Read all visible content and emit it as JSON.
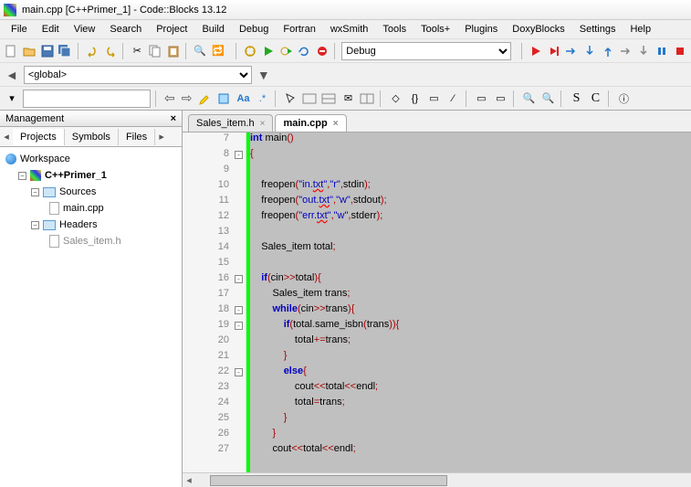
{
  "title": "main.cpp [C++Primer_1] - Code::Blocks 13.12",
  "menu": [
    "File",
    "Edit",
    "View",
    "Search",
    "Project",
    "Build",
    "Debug",
    "Fortran",
    "wxSmith",
    "Tools",
    "Tools+",
    "Plugins",
    "DoxyBlocks",
    "Settings",
    "Help"
  ],
  "scope_combo": "<global>",
  "build_target": "Debug",
  "management": {
    "title": "Management",
    "tabs": [
      "Projects",
      "Symbols",
      "Files"
    ],
    "active_tab": 0,
    "tree": {
      "workspace": "Workspace",
      "project": "C++Primer_1",
      "folders": [
        {
          "name": "Sources",
          "files": [
            "main.cpp"
          ]
        },
        {
          "name": "Headers",
          "files": [
            "Sales_item.h"
          ]
        }
      ]
    }
  },
  "editor": {
    "tabs": [
      {
        "label": "Sales_item.h",
        "active": false
      },
      {
        "label": "main.cpp",
        "active": true
      }
    ],
    "lines": [
      {
        "n": 7,
        "fold": "",
        "html": "<span class='kw'>int</span> main<span class='op'>()</span>"
      },
      {
        "n": 8,
        "fold": "-",
        "html": "<span class='op'>{</span>"
      },
      {
        "n": 9,
        "fold": "",
        "html": ""
      },
      {
        "n": 10,
        "fold": "",
        "html": "    freopen<span class='op'>(</span><span class='str'>\"in.<span class='err'>txt</span>\"</span><span class='op'>,</span><span class='str'>\"r\"</span><span class='op'>,</span>stdin<span class='op'>);</span>"
      },
      {
        "n": 11,
        "fold": "",
        "html": "    freopen<span class='op'>(</span><span class='str'>\"out.<span class='err'>txt</span>\"</span><span class='op'>,</span><span class='str'>\"w\"</span><span class='op'>,</span>stdout<span class='op'>);</span>"
      },
      {
        "n": 12,
        "fold": "",
        "html": "    freopen<span class='op'>(</span><span class='str'>\"err.<span class='err'>txt</span>\"</span><span class='op'>,</span><span class='str'>\"w\"</span><span class='op'>,</span>stderr<span class='op'>);</span>"
      },
      {
        "n": 13,
        "fold": "",
        "html": ""
      },
      {
        "n": 14,
        "fold": "",
        "html": "    Sales_item total<span class='op'>;</span>"
      },
      {
        "n": 15,
        "fold": "",
        "html": ""
      },
      {
        "n": 16,
        "fold": "-",
        "html": "    <span class='kw'>if</span><span class='op'>(</span>cin<span class='op'>&gt;&gt;</span>total<span class='op'>){</span>"
      },
      {
        "n": 17,
        "fold": "",
        "html": "        Sales_item trans<span class='op'>;</span>"
      },
      {
        "n": 18,
        "fold": "-",
        "html": "        <span class='kw'>while</span><span class='op'>(</span>cin<span class='op'>&gt;&gt;</span>trans<span class='op'>){</span>"
      },
      {
        "n": 19,
        "fold": "-",
        "html": "            <span class='kw'>if</span><span class='op'>(</span>total<span class='op'>.</span>same_isbn<span class='op'>(</span>trans<span class='op'>)){</span>"
      },
      {
        "n": 20,
        "fold": "",
        "html": "                total<span class='op'>+=</span>trans<span class='op'>;</span>"
      },
      {
        "n": 21,
        "fold": "",
        "html": "            <span class='op'>}</span>"
      },
      {
        "n": 22,
        "fold": "-",
        "html": "            <span class='kw'>else</span><span class='op'>{</span>"
      },
      {
        "n": 23,
        "fold": "",
        "html": "                cout<span class='op'>&lt;&lt;</span>total<span class='op'>&lt;&lt;</span>endl<span class='op'>;</span>"
      },
      {
        "n": 24,
        "fold": "",
        "html": "                total<span class='op'>=</span>trans<span class='op'>;</span>"
      },
      {
        "n": 25,
        "fold": "",
        "html": "            <span class='op'>}</span>"
      },
      {
        "n": 26,
        "fold": "",
        "html": "        <span class='op'>}</span>"
      },
      {
        "n": 27,
        "fold": "",
        "html": "        cout<span class='op'>&lt;&lt;</span>total<span class='op'>&lt;&lt;</span>endl<span class='op'>;</span>"
      }
    ]
  }
}
